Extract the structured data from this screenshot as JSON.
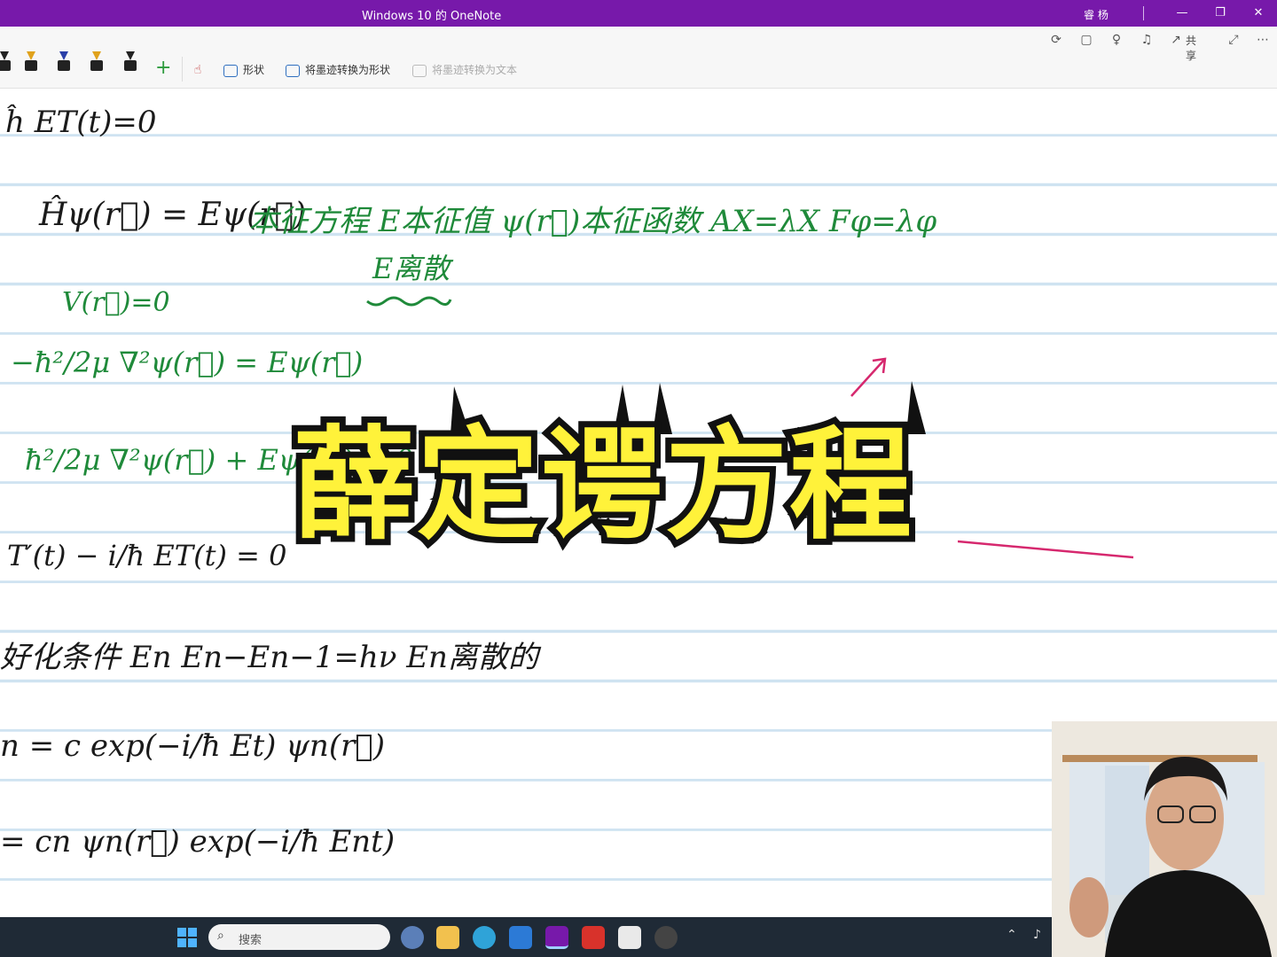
{
  "window": {
    "title": "Windows 10 的 OneNote",
    "user": "睿 杨"
  },
  "window_controls": [
    "—",
    "❐",
    "✕"
  ],
  "top_actions": {
    "share_label": "共享"
  },
  "toolbar": {
    "shapes_label": "形状",
    "ink_to_shape_label": "将墨迹转换为形状",
    "ink_to_text_label": "将墨迹转换为文本",
    "pen_colors": [
      "#1a1a1a",
      "#e0a21c",
      "#1a1a1a",
      "#e0a21c",
      "#1a1a1a"
    ]
  },
  "note": {
    "lines": [
      {
        "text": "ĥ ET(t)=0",
        "color": "black"
      },
      {
        "text": "Ĥψ(r⃗) = Eψ(r⃗)",
        "color": "black"
      },
      {
        "text": "本征方程  E本征值  ψ(r⃗)本征函数    AX=λX  Fφ=λφ",
        "color": "green"
      },
      {
        "text": "E离散",
        "color": "green"
      },
      {
        "text": "V(r⃗)=0",
        "color": "green"
      },
      {
        "text": "−ħ²/2μ ∇²ψ(r⃗) = Eψ(r⃗)",
        "color": "green"
      },
      {
        "text": "ħ²/2μ ∇²ψ(r⃗) + Eψ(r⃗) = 0",
        "color": "green"
      },
      {
        "text": "T′(t) − i/ħ ET(t) = 0",
        "color": "black"
      },
      {
        "text": "好化条件    En        En−En−1=hν     En离散的",
        "color": "black"
      },
      {
        "text": "n = c exp(−i/ħ Et)      ψn(r⃗)",
        "color": "black"
      },
      {
        "text": "= cn ψn(r⃗) exp(−i/ħ Ent)",
        "color": "black"
      }
    ]
  },
  "overlay": {
    "title": "薛定谔方程"
  },
  "taskbar": {
    "search_placeholder": "搜索"
  }
}
